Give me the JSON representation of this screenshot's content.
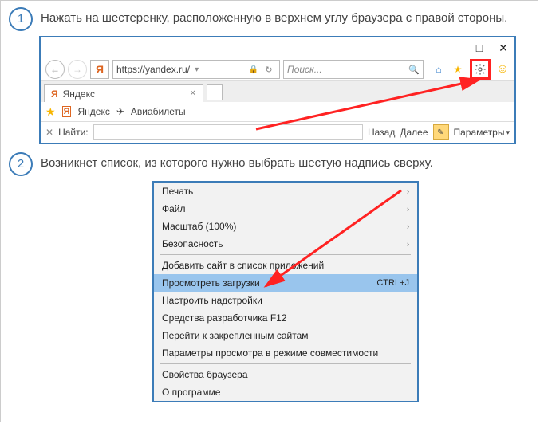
{
  "steps": {
    "s1": {
      "num": "1",
      "text": "Нажать на шестеренку, расположенную в верхнем углу браузера с правой стороны."
    },
    "s2": {
      "num": "2",
      "text": "Возникнет список, из которого нужно выбрать шестую надпись сверху."
    }
  },
  "browser": {
    "ya_letter": "Я",
    "url": "https://yandex.ru/",
    "search_placeholder": "Поиск...",
    "tab_title": "Яндекс",
    "bookmarks": {
      "yandex": "Яндекс",
      "avia": "Авиабилеты"
    },
    "find": {
      "label": "Найти:",
      "back": "Назад",
      "next": "Далее",
      "params": "Параметры"
    }
  },
  "menu": {
    "print": "Печать",
    "file": "Файл",
    "zoom": "Масштаб (100%)",
    "security": "Безопасность",
    "add_site": "Добавить сайт в список приложений",
    "downloads": "Просмотреть загрузки",
    "downloads_kb": "CTRL+J",
    "addons": "Настроить надстройки",
    "f12": "Средства разработчика F12",
    "pinned": "Перейти к закрепленным сайтам",
    "compat": "Параметры просмотра в режиме совместимости",
    "props": "Свойства браузера",
    "about": "О программе"
  }
}
